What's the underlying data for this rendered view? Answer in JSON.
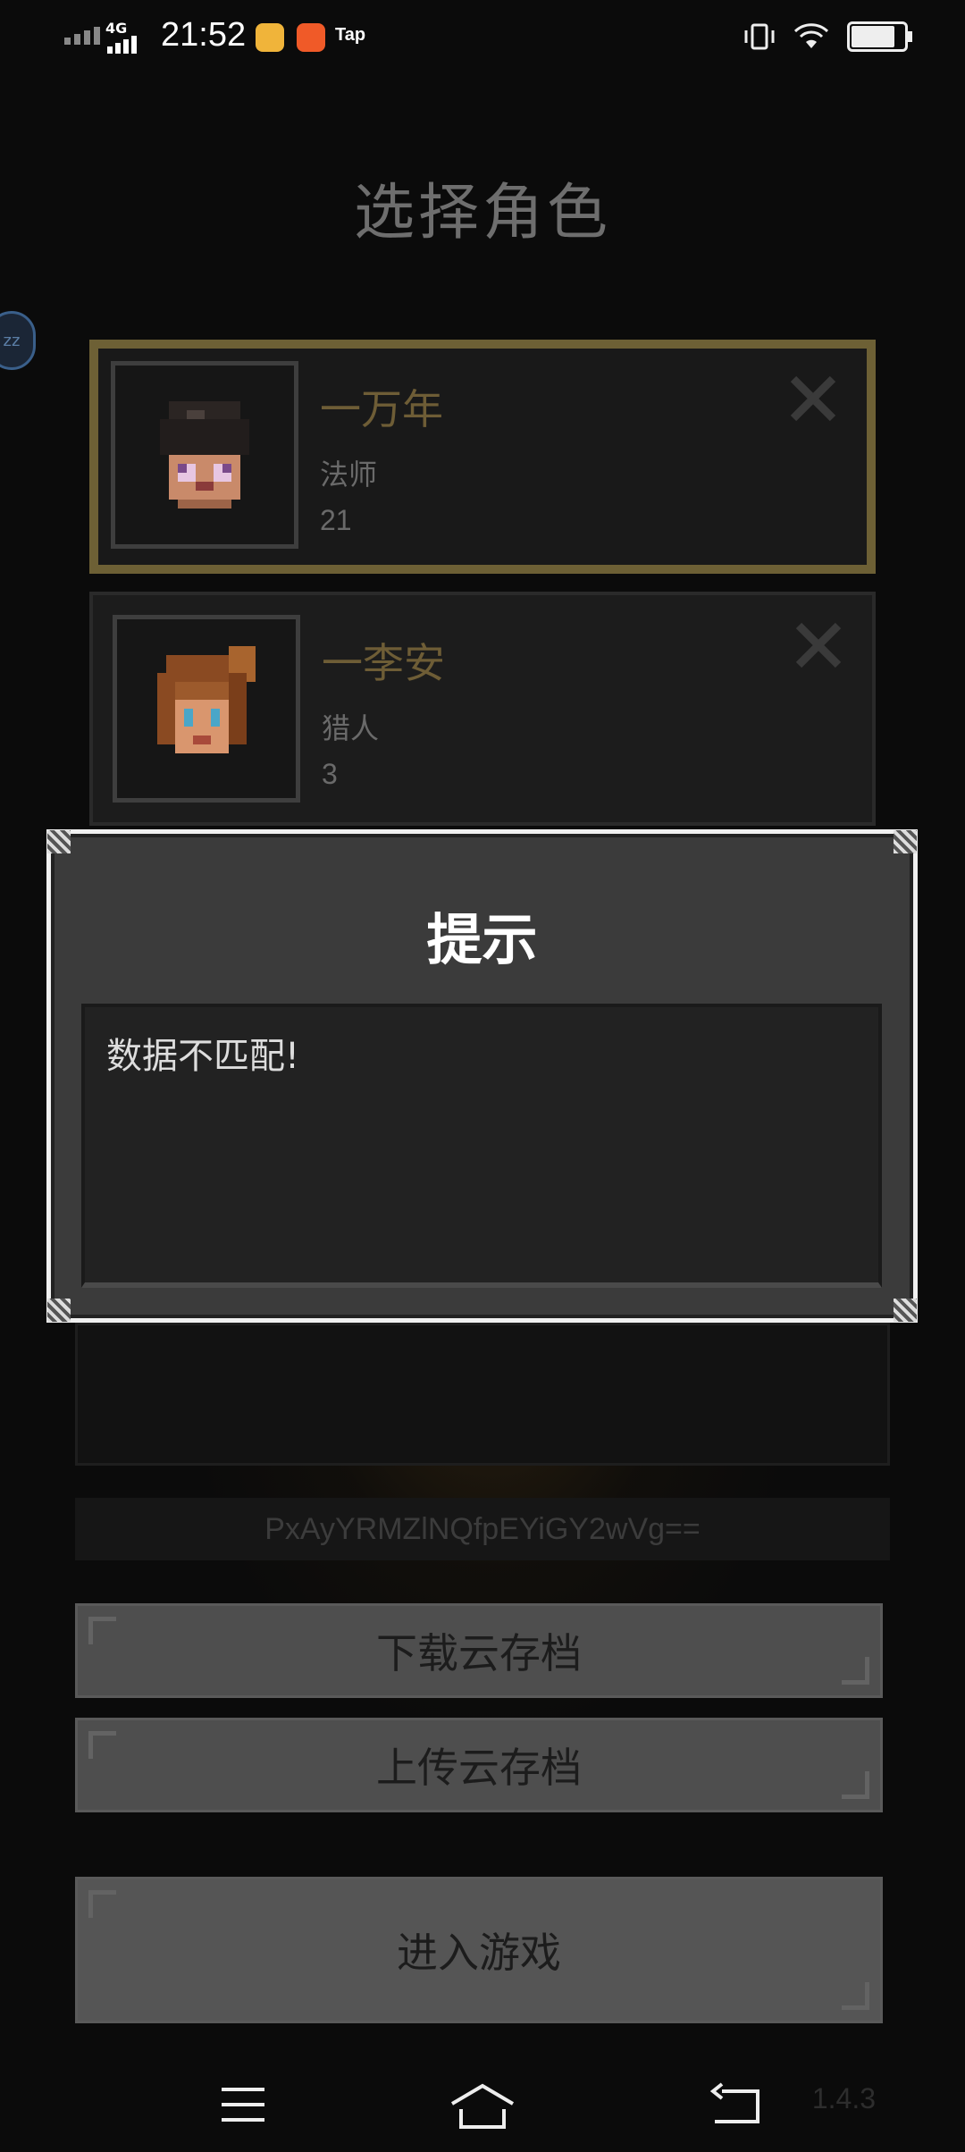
{
  "status_bar": {
    "network": "4G",
    "time": "21:52",
    "tap_label": "Tap",
    "battery_level": 0.88
  },
  "screen": {
    "title": "选择角色",
    "side_button": "zz"
  },
  "characters": [
    {
      "name": "一万年",
      "class": "法师",
      "level": "21",
      "selected": true
    },
    {
      "name": "一李安",
      "class": "猎人",
      "level": "3",
      "selected": false
    }
  ],
  "save_code": "PxAyYRMZlNQfpEYiGY2wVg==",
  "buttons": {
    "download": "下载云存档",
    "upload": "上传云存档",
    "enter": "进入游戏"
  },
  "dialog": {
    "title": "提示",
    "message": "数据不匹配!"
  },
  "version": "1.4.3",
  "colors": {
    "name_gold": "#6e5d36",
    "selected_border": "#6d6035",
    "dialog_bg": "#3b3b3b"
  }
}
